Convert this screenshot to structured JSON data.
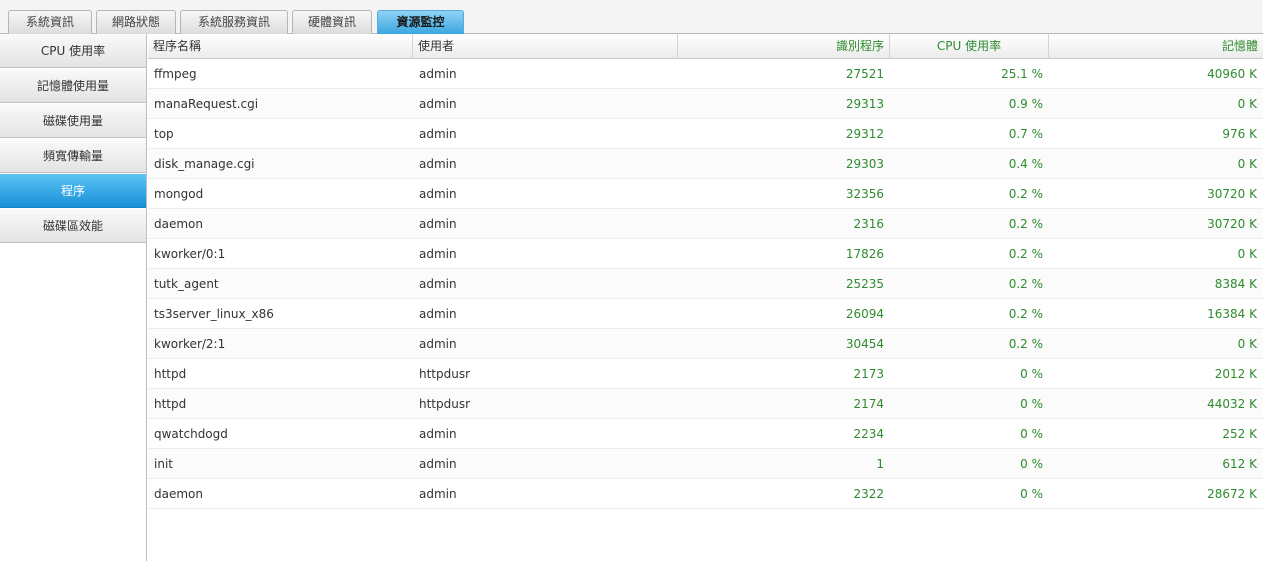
{
  "tabs": [
    {
      "label": "系統資訊",
      "active": false
    },
    {
      "label": "網路狀態",
      "active": false
    },
    {
      "label": "系統服務資訊",
      "active": false
    },
    {
      "label": "硬體資訊",
      "active": false
    },
    {
      "label": "資源監控",
      "active": true
    }
  ],
  "sidebar": {
    "items": [
      {
        "label": "CPU 使用率",
        "active": false
      },
      {
        "label": "記憶體使用量",
        "active": false
      },
      {
        "label": "磁碟使用量",
        "active": false
      },
      {
        "label": "頻寬傳輸量",
        "active": false
      },
      {
        "label": "程序",
        "active": true
      },
      {
        "label": "磁碟區效能",
        "active": false
      }
    ]
  },
  "table": {
    "headers": {
      "name": "程序名稱",
      "user": "使用者",
      "pid": "識別程序",
      "cpu": "CPU 使用率",
      "mem": "記憶體"
    },
    "rows": [
      {
        "name": "ffmpeg",
        "user": "admin",
        "pid": "27521",
        "cpu": "25.1 %",
        "mem": "40960 K"
      },
      {
        "name": "manaRequest.cgi",
        "user": "admin",
        "pid": "29313",
        "cpu": "0.9 %",
        "mem": "0 K"
      },
      {
        "name": "top",
        "user": "admin",
        "pid": "29312",
        "cpu": "0.7 %",
        "mem": "976 K"
      },
      {
        "name": "disk_manage.cgi",
        "user": "admin",
        "pid": "29303",
        "cpu": "0.4 %",
        "mem": "0 K"
      },
      {
        "name": "mongod",
        "user": "admin",
        "pid": "32356",
        "cpu": "0.2 %",
        "mem": "30720 K"
      },
      {
        "name": "daemon",
        "user": "admin",
        "pid": "2316",
        "cpu": "0.2 %",
        "mem": "30720 K"
      },
      {
        "name": "kworker/0:1",
        "user": "admin",
        "pid": "17826",
        "cpu": "0.2 %",
        "mem": "0 K"
      },
      {
        "name": "tutk_agent",
        "user": "admin",
        "pid": "25235",
        "cpu": "0.2 %",
        "mem": "8384 K"
      },
      {
        "name": "ts3server_linux_x86",
        "user": "admin",
        "pid": "26094",
        "cpu": "0.2 %",
        "mem": "16384 K"
      },
      {
        "name": "kworker/2:1",
        "user": "admin",
        "pid": "30454",
        "cpu": "0.2 %",
        "mem": "0 K"
      },
      {
        "name": "httpd",
        "user": "httpdusr",
        "pid": "2173",
        "cpu": "0 %",
        "mem": "2012 K"
      },
      {
        "name": "httpd",
        "user": "httpdusr",
        "pid": "2174",
        "cpu": "0 %",
        "mem": "44032 K"
      },
      {
        "name": "qwatchdogd",
        "user": "admin",
        "pid": "2234",
        "cpu": "0 %",
        "mem": "252 K"
      },
      {
        "name": "init",
        "user": "admin",
        "pid": "1",
        "cpu": "0 %",
        "mem": "612 K"
      },
      {
        "name": "daemon",
        "user": "admin",
        "pid": "2322",
        "cpu": "0 %",
        "mem": "28672 K"
      }
    ]
  },
  "colors": {
    "accent": "#1890d8",
    "value_green": "#2e8b2e"
  }
}
